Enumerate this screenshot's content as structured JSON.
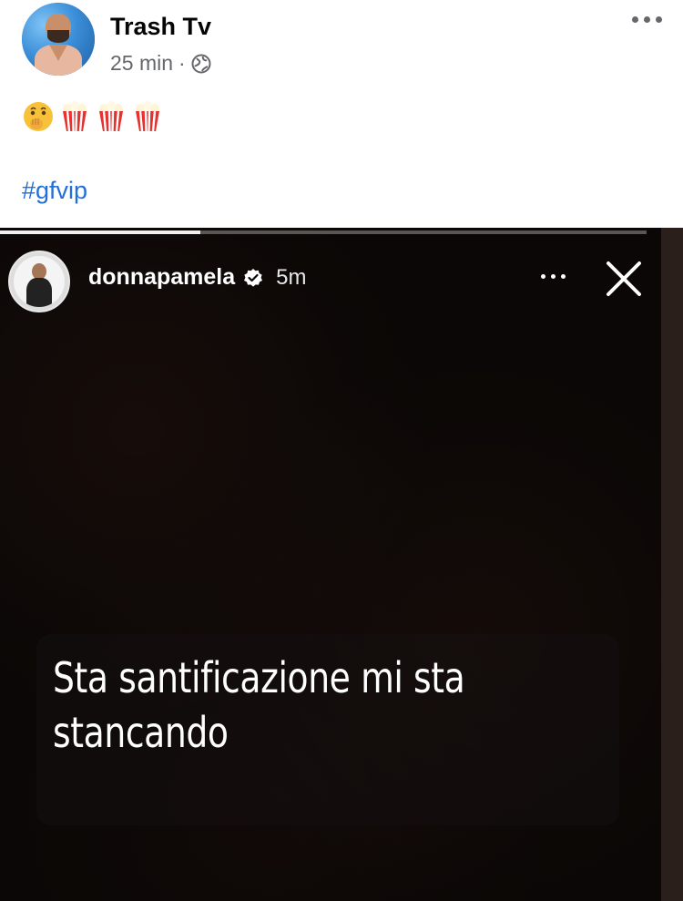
{
  "post": {
    "author": "Trash Tv",
    "time": "25 min",
    "separator": "·",
    "audience_icon": "globe-icon",
    "more_icon": "more-options-icon",
    "emojis": [
      "shushing-face-emoji",
      "popcorn-emoji",
      "popcorn-emoji",
      "popcorn-emoji"
    ],
    "hashtag": "#gfvip"
  },
  "story": {
    "username": "donnapamela",
    "verified_icon": "verified-badge-icon",
    "time": "5m",
    "more_icon": "more-options-icon",
    "close_icon": "close-icon",
    "progress": 0.31,
    "caption": "Sta santificazione mi sta stancando"
  },
  "colors": {
    "hashtag": "#216fdb",
    "meta_gray": "#65676b",
    "story_bg": "#0a0706"
  }
}
